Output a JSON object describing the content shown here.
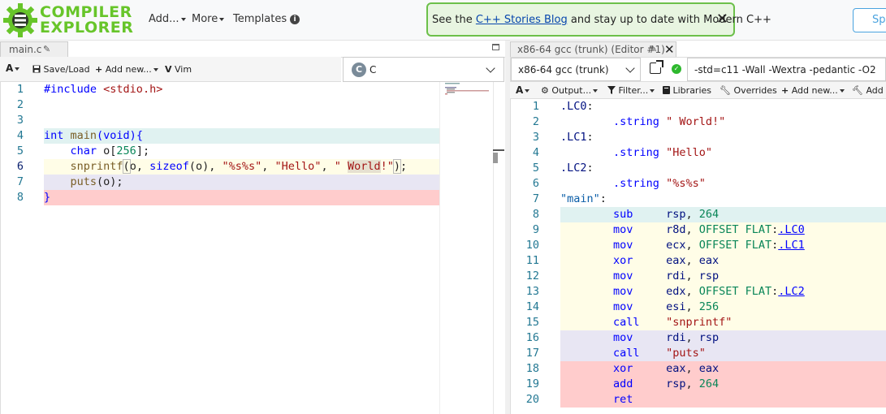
{
  "navbar": {
    "logo_line1": "COMPILER",
    "logo_line2": "EXPLORER",
    "add_label": "Add...",
    "more_label": "More",
    "templates_label": "Templates",
    "info_icon": "info-icon",
    "alert_prefix": "See the ",
    "alert_link": "C++ Stories Blog",
    "alert_suffix": " and stay up to date with Modern C++",
    "alert_close": "✕",
    "sponsor_label": "Spo"
  },
  "editor": {
    "tab_label": "main.c",
    "toolbar": {
      "font_label": "A",
      "save_label": "Save/Load",
      "add_new_label": "Add new...",
      "vim_label": "Vim"
    },
    "language": "C",
    "line_numbers": [
      "1",
      "2",
      "3",
      "4",
      "5",
      "6",
      "7",
      "8"
    ]
  },
  "compiler": {
    "tab_label": "x86-64 gcc (trunk) (Editor #1)",
    "name": "x86-64 gcc (trunk)",
    "options": "-std=c11 -Wall -Wextra -pedantic -O2",
    "toolbar": {
      "font_label": "A",
      "output_label": "Output...",
      "filter_label": "Filter...",
      "libraries_label": "Libraries",
      "overrides_label": "Overrides",
      "add_new_label": "Add new...",
      "add_tool_label": "Add t"
    },
    "line_numbers": [
      "1",
      "2",
      "3",
      "4",
      "5",
      "6",
      "7",
      "8",
      "9",
      "10",
      "11",
      "12",
      "13",
      "14",
      "15",
      "16",
      "17",
      "18",
      "19",
      "20"
    ]
  },
  "colors": {
    "accent_green": "#67c52a",
    "line_teal": "#e0f2f1",
    "line_yellow": "#fffde7",
    "line_lavender": "#e8e6f3",
    "line_red": "#ffcccc"
  }
}
